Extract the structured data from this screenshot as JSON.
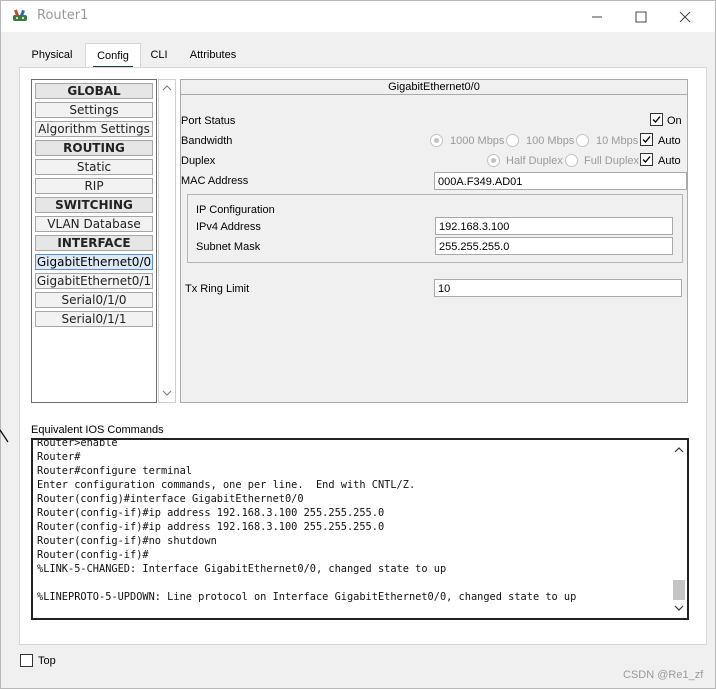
{
  "window": {
    "title": "Router1"
  },
  "tabs": [
    {
      "label": "Physical"
    },
    {
      "label": "Config"
    },
    {
      "label": "CLI"
    },
    {
      "label": "Attributes"
    }
  ],
  "sidebar": {
    "items": [
      {
        "label": "GLOBAL",
        "kind": "header"
      },
      {
        "label": "Settings",
        "kind": "item"
      },
      {
        "label": "Algorithm Settings",
        "kind": "item"
      },
      {
        "label": "ROUTING",
        "kind": "header"
      },
      {
        "label": "Static",
        "kind": "item"
      },
      {
        "label": "RIP",
        "kind": "item"
      },
      {
        "label": "SWITCHING",
        "kind": "header"
      },
      {
        "label": "VLAN Database",
        "kind": "item"
      },
      {
        "label": "INTERFACE",
        "kind": "header"
      },
      {
        "label": "GigabitEthernet0/0",
        "kind": "item",
        "selected": true
      },
      {
        "label": "GigabitEthernet0/1",
        "kind": "item"
      },
      {
        "label": "Serial0/1/0",
        "kind": "item"
      },
      {
        "label": "Serial0/1/1",
        "kind": "item"
      }
    ]
  },
  "config": {
    "title": "GigabitEthernet0/0",
    "port_status": {
      "label": "Port Status",
      "on_label": "On",
      "checked": true
    },
    "bandwidth": {
      "label": "Bandwidth",
      "options": [
        "1000 Mbps",
        "100 Mbps",
        "10 Mbps"
      ],
      "selected": "1000 Mbps",
      "auto_label": "Auto",
      "auto_checked": true
    },
    "duplex": {
      "label": "Duplex",
      "options": [
        "Half Duplex",
        "Full Duplex"
      ],
      "selected": "Half Duplex",
      "auto_label": "Auto",
      "auto_checked": true
    },
    "mac": {
      "label": "MAC Address",
      "value": "000A.F349.AD01"
    },
    "ip_config": {
      "title": "IP Configuration",
      "ipv4_label": "IPv4 Address",
      "ipv4_value": "192.168.3.100",
      "mask_label": "Subnet Mask",
      "mask_value": "255.255.255.0"
    },
    "tx_ring": {
      "label": "Tx Ring Limit",
      "value": "10"
    }
  },
  "ios": {
    "label": "Equivalent IOS Commands",
    "text": "Router>enable\nRouter#\nRouter#configure terminal\nEnter configuration commands, one per line.  End with CNTL/Z.\nRouter(config)#interface GigabitEthernet0/0\nRouter(config-if)#ip address 192.168.3.100 255.255.255.0\nRouter(config-if)#ip address 192.168.3.100 255.255.255.0\nRouter(config-if)#no shutdown\nRouter(config-if)#\n%LINK-5-CHANGED: Interface GigabitEthernet0/0, changed state to up\n\n%LINEPROTO-5-UPDOWN: Line protocol on Interface GigabitEthernet0/0, changed state to up"
  },
  "footer": {
    "top_label": "Top",
    "top_checked": false
  },
  "watermark": "CSDN @Re1_zf",
  "colors": {
    "tab_underline": "#1a3a4f",
    "selected_item": "#dfe9f5",
    "selected_border": "#5b8fc9"
  }
}
